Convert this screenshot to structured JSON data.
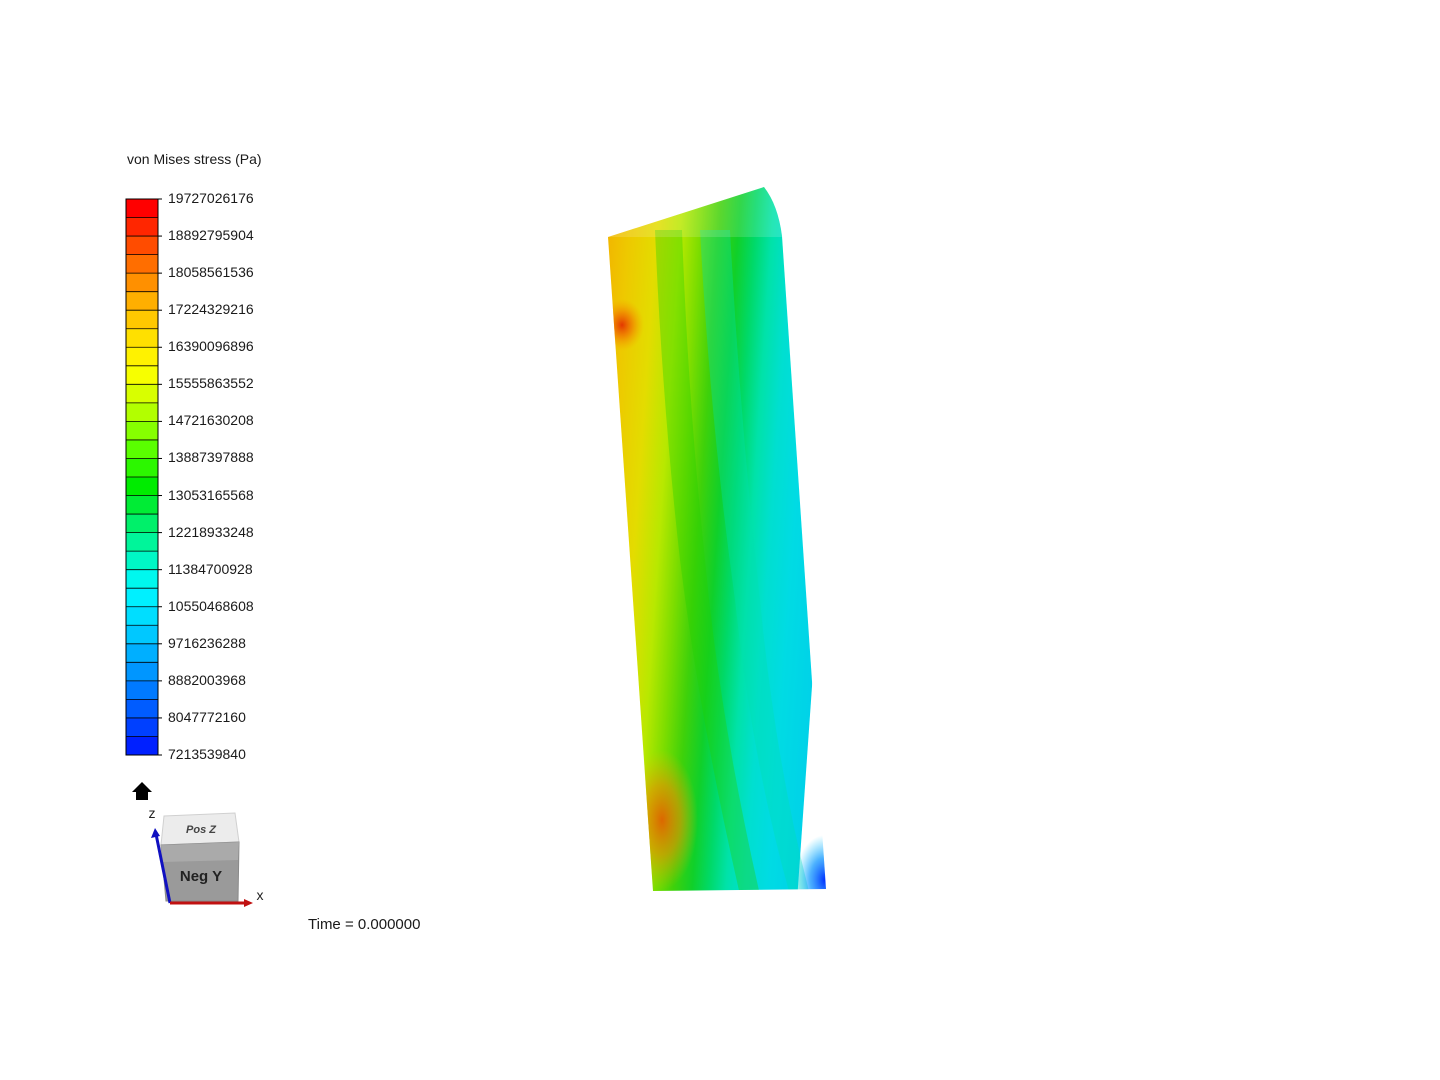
{
  "legend": {
    "title": "von Mises stress (Pa)",
    "tick_labels": [
      "19727026176",
      "18892795904",
      "18058561536",
      "17224329216",
      "16390096896",
      "15555863552",
      "14721630208",
      "13887397888",
      "13053165568",
      "12218933248",
      "11384700928",
      "10550468608",
      "9716236288",
      "8882003968",
      "8047772160",
      "7213539840"
    ],
    "colors": [
      "#ff0000",
      "#ff2600",
      "#ff4c00",
      "#ff6e00",
      "#ff9000",
      "#ffaf00",
      "#ffc800",
      "#ffe000",
      "#fff200",
      "#f7ff00",
      "#d8ff00",
      "#b2ff00",
      "#86ff00",
      "#5aff00",
      "#2cf700",
      "#00ec00",
      "#00ec35",
      "#00f06a",
      "#00f59a",
      "#00f7c6",
      "#00f8ee",
      "#00f0ff",
      "#00deff",
      "#00c8ff",
      "#00afff",
      "#0096ff",
      "#007aff",
      "#005cff",
      "#0040ff",
      "#0020ff"
    ]
  },
  "time_label": "Time = 0.000000",
  "orientation": {
    "top_face": "Pos Z",
    "front_face": "Neg Y",
    "axis_z": "z",
    "axis_x": "x",
    "z_color": "#1010c0",
    "x_color": "#c01010"
  },
  "home_icon": "home-icon"
}
